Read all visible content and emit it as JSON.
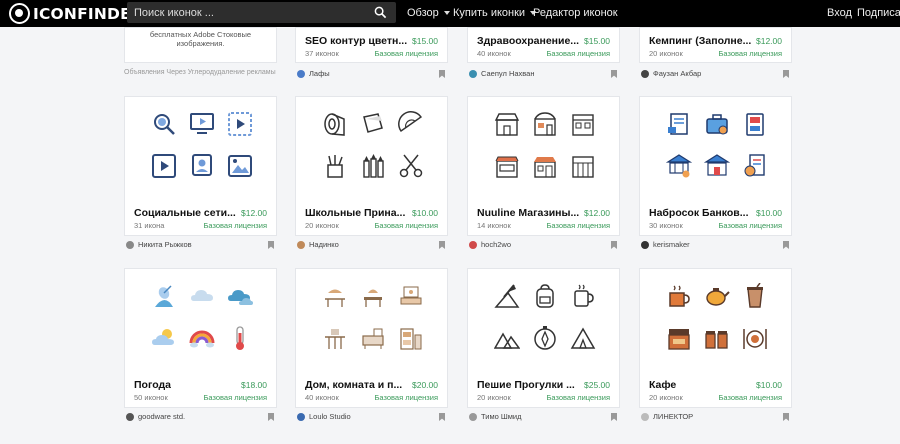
{
  "nav": {
    "logo": "ICONFINDER",
    "search_placeholder": "Поиск иконок ...",
    "links": [
      "Обзор",
      "Купить иконки",
      "Редактор иконок"
    ],
    "login": "Вход",
    "subscribe": "Подписать"
  },
  "ad": {
    "text": "бесплатных Adobe Стоковые изображения.",
    "caption": "Объявления Через Углерод",
    "caption_removal": "удаление рекламы"
  },
  "top_cards": [
    {
      "title": "SEO контур цветн...",
      "price": "$15.00",
      "count": "37 иконок",
      "license": "Базовая лицензия",
      "author": "Лафы"
    },
    {
      "title": "Здравоохранение...",
      "price": "$15.00",
      "count": "40 иконок",
      "license": "Базовая лицензия",
      "author": "Саепул Нахван"
    },
    {
      "title": "Кемпинг (Заполне...",
      "price": "$12.00",
      "count": "20 иконок",
      "license": "Базовая лицензия",
      "author": "Фаузан Акбар"
    }
  ],
  "row2": [
    {
      "title": "Социальные сети...",
      "price": "$12.00",
      "count": "31 икона",
      "license": "Базовая лицензия",
      "author": "Никита Рыжков"
    },
    {
      "title": "Школьные Прина...",
      "price": "$10.00",
      "count": "20 иконок",
      "license": "Базовая лицензия",
      "author": "Надинко"
    },
    {
      "title": "Nuuline Магазины...",
      "price": "$12.00",
      "count": "14 иконок",
      "license": "Базовая лицензия",
      "author": "hoch2wo"
    },
    {
      "title": "Набросок Банков...",
      "price": "$10.00",
      "count": "30 иконок",
      "license": "Базовая лицензия",
      "author": "kerismaker"
    }
  ],
  "row3": [
    {
      "title": "Погода",
      "price": "$18.00",
      "count": "50 иконок",
      "license": "Базовая лицензия",
      "author": "goodware std."
    },
    {
      "title": "Дом, комната и п...",
      "price": "$20.00",
      "count": "40 иконок",
      "license": "Базовая лицензия",
      "author": "Loulo Studio"
    },
    {
      "title": "Пешие Прогулки ...",
      "price": "$25.00",
      "count": "20 иконок",
      "license": "Базовая лицензия",
      "author": "Тимо Шмид"
    },
    {
      "title": "Кафе",
      "price": "$10.00",
      "count": "20 иконок",
      "license": "Базовая лицензия",
      "author": "ЛИНЕКТОР"
    }
  ],
  "colors": {
    "accent_green": "#3a9a5a",
    "nav_bg": "#000000"
  }
}
